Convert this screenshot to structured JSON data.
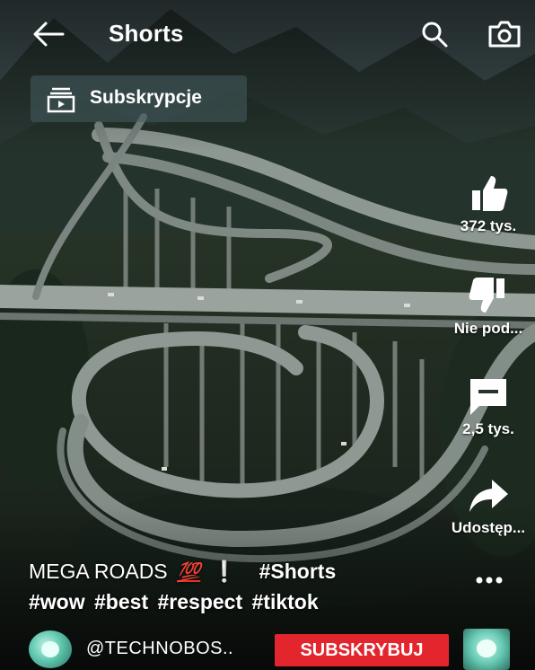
{
  "header": {
    "title": "Shorts",
    "back_icon": "arrow-left-icon",
    "search_icon": "search-icon",
    "camera_icon": "camera-icon"
  },
  "subscriptions_chip": {
    "label": "Subskrypcje",
    "icon": "subscriptions-icon"
  },
  "actions": [
    {
      "id": "like",
      "icon": "thumbs-up-icon",
      "label": "372 tys."
    },
    {
      "id": "dislike",
      "icon": "thumbs-down-icon",
      "label": "Nie pod..."
    },
    {
      "id": "comments",
      "icon": "comment-icon",
      "label": "2,5 tys."
    },
    {
      "id": "share",
      "icon": "share-arrow-icon",
      "label": "Udostęp..."
    }
  ],
  "more_icon": "more-dots-icon",
  "caption": {
    "title": "MEGA ROADS",
    "emoji": "💯",
    "exclamation": "❕",
    "line1_tag": "#Shorts",
    "line2_tags": [
      "#wow",
      "#best",
      "#respect",
      "#tiktok"
    ]
  },
  "channel": {
    "handle": "@TECHNOBOS..",
    "subscribe_label": "SUBSKRYBUJ"
  },
  "colors": {
    "subscribe_red": "#e3262e",
    "emoji_red": "#e8302a",
    "exclamation_blue": "#2d8cf0"
  }
}
